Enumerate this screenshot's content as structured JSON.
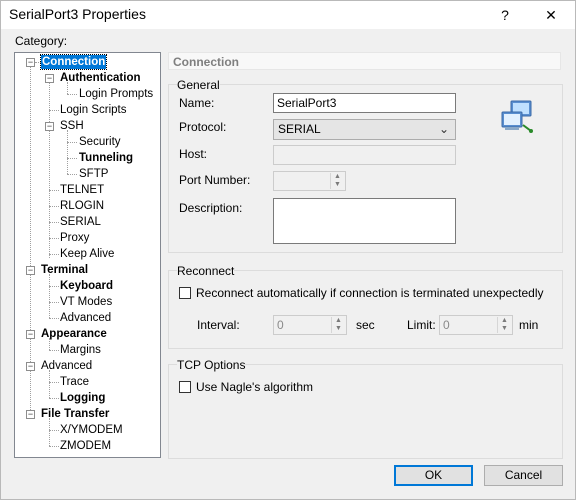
{
  "window": {
    "title": "SerialPort3 Properties",
    "help_glyph": "?",
    "close_glyph": "✕"
  },
  "category_label": "Category:",
  "tree": {
    "connection": "Connection",
    "authentication": "Authentication",
    "login_prompts": "Login Prompts",
    "login_scripts": "Login Scripts",
    "ssh": "SSH",
    "security": "Security",
    "tunneling": "Tunneling",
    "sftp": "SFTP",
    "telnet": "TELNET",
    "rlogin": "RLOGIN",
    "serial": "SERIAL",
    "proxy": "Proxy",
    "keep_alive": "Keep Alive",
    "terminal": "Terminal",
    "keyboard": "Keyboard",
    "vt_modes": "VT Modes",
    "advanced_terminal": "Advanced",
    "appearance": "Appearance",
    "margins": "Margins",
    "advanced": "Advanced",
    "trace": "Trace",
    "logging": "Logging",
    "file_transfer": "File Transfer",
    "xymodem": "X/YMODEM",
    "zmodem": "ZMODEM",
    "toggle_glyph": "−"
  },
  "panel_title": "Connection",
  "general": {
    "title": "General",
    "name_label": "Name:",
    "name_value": "SerialPort3",
    "protocol_label": "Protocol:",
    "protocol_value": "SERIAL",
    "host_label": "Host:",
    "host_value": "",
    "port_label": "Port Number:",
    "port_value": "",
    "description_label": "Description:",
    "description_value": ""
  },
  "reconnect": {
    "title": "Reconnect",
    "checkbox_label": "Reconnect automatically if connection is terminated unexpectedly",
    "checked": false,
    "interval_label": "Interval:",
    "interval_value": "0",
    "interval_unit": "sec",
    "limit_label": "Limit:",
    "limit_value": "0",
    "limit_unit": "min"
  },
  "tcp": {
    "title": "TCP Options",
    "nagle_label": "Use Nagle's algorithm",
    "checked": false
  },
  "buttons": {
    "ok": "OK",
    "cancel": "Cancel"
  },
  "colors": {
    "selection": "#0078d7",
    "default_button_border": "#0078d7"
  }
}
